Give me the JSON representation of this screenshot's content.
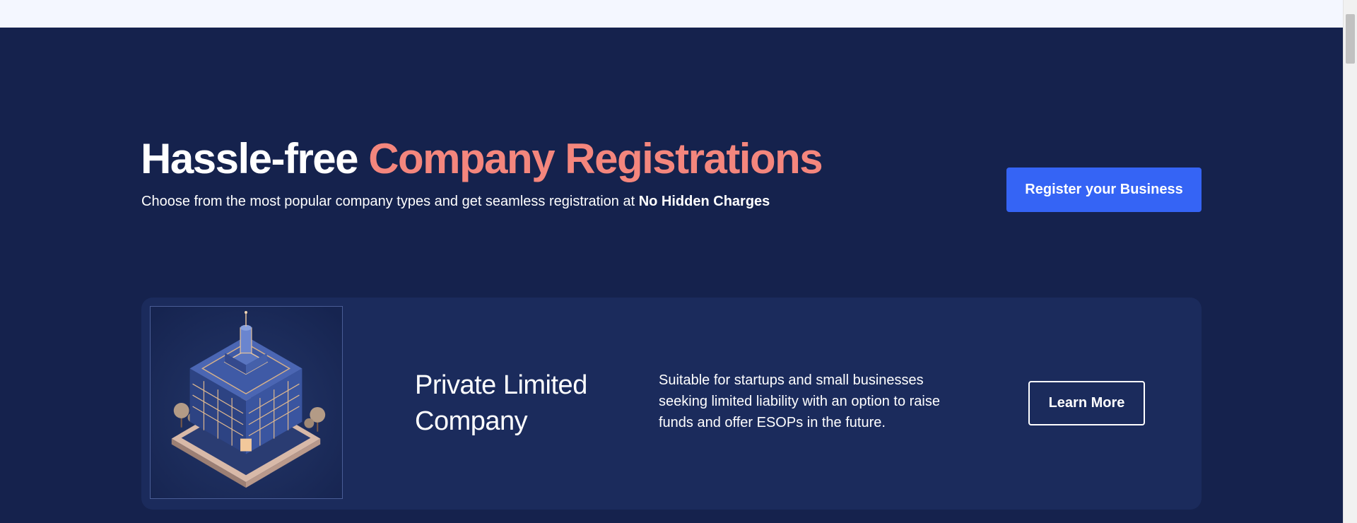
{
  "hero": {
    "headline_plain": "Hassle-free",
    "headline_accent": "Company Registrations",
    "subtitle_text": "Choose from the most popular company types and get seamless registration at",
    "subtitle_bold": "No Hidden Charges",
    "cta_label": "Register your Business"
  },
  "card": {
    "title": "Private Limited Company",
    "description": "Suitable for startups and small businesses seeking limited liability with an option to raise funds and offer ESOPs in the future.",
    "button_label": "Learn More",
    "image_icon": "isometric-building-illustration"
  },
  "colors": {
    "hero_background": "#15224d",
    "card_background": "#1b2b5c",
    "accent_text": "#f4867d",
    "primary_button": "#3564f5",
    "top_strip": "#f4f7ff"
  }
}
